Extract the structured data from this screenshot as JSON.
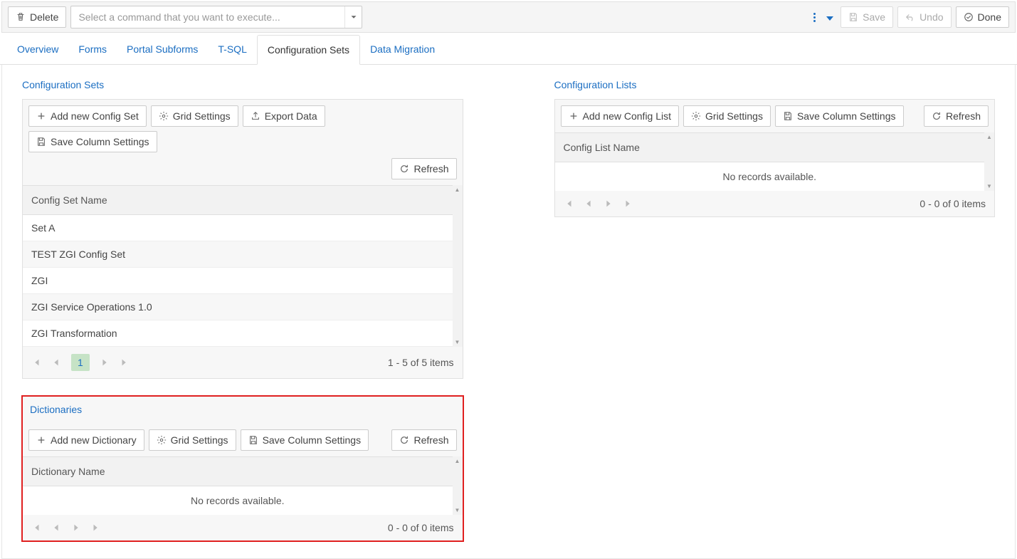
{
  "toolbar": {
    "delete_label": "Delete",
    "command_placeholder": "Select a command that you want to execute...",
    "save_label": "Save",
    "undo_label": "Undo",
    "done_label": "Done"
  },
  "tabs": [
    {
      "label": "Overview",
      "active": false
    },
    {
      "label": "Forms",
      "active": false
    },
    {
      "label": "Portal Subforms",
      "active": false
    },
    {
      "label": "T-SQL",
      "active": false
    },
    {
      "label": "Configuration Sets",
      "active": true
    },
    {
      "label": "Data Migration",
      "active": false
    }
  ],
  "config_sets": {
    "title": "Configuration Sets",
    "buttons": {
      "add": "Add new Config Set",
      "grid": "Grid Settings",
      "export": "Export Data",
      "save_cols": "Save Column Settings",
      "refresh": "Refresh"
    },
    "column": "Config Set Name",
    "rows": [
      "Set A",
      "TEST ZGI Config Set",
      "ZGI",
      "ZGI Service Operations 1.0",
      "ZGI Transformation"
    ],
    "page": "1",
    "pager_info": "1 - 5 of 5 items"
  },
  "config_lists": {
    "title": "Configuration Lists",
    "buttons": {
      "add": "Add new Config List",
      "grid": "Grid Settings",
      "save_cols": "Save Column Settings",
      "refresh": "Refresh"
    },
    "column": "Config List Name",
    "empty": "No records available.",
    "pager_info": "0 - 0 of 0 items"
  },
  "dictionaries": {
    "title": "Dictionaries",
    "buttons": {
      "add": "Add new Dictionary",
      "grid": "Grid Settings",
      "save_cols": "Save Column Settings",
      "refresh": "Refresh"
    },
    "column": "Dictionary Name",
    "empty": "No records available.",
    "pager_info": "0 - 0 of 0 items"
  }
}
